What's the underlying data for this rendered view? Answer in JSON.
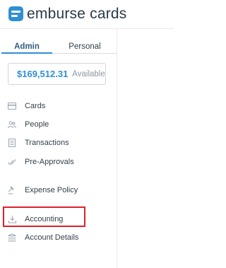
{
  "brand": {
    "logo_text": "emburse cards"
  },
  "tabs": [
    {
      "label": "Admin",
      "active": true
    },
    {
      "label": "Personal",
      "active": false
    }
  ],
  "balance": {
    "amount": "$169,512.31",
    "label": "Available"
  },
  "nav": [
    {
      "label": "Cards",
      "icon": "card-icon"
    },
    {
      "label": "People",
      "icon": "people-icon"
    },
    {
      "label": "Transactions",
      "icon": "receipt-icon"
    },
    {
      "label": "Pre-Approvals",
      "icon": "checkmark-icon"
    },
    {
      "label": "Expense Policy",
      "icon": "gavel-icon"
    },
    {
      "label": "Accounting",
      "icon": "download-icon"
    },
    {
      "label": "Account Details",
      "icon": "bank-icon"
    }
  ],
  "colors": {
    "accent": "#2f8fd1",
    "highlight": "#e0202a"
  }
}
